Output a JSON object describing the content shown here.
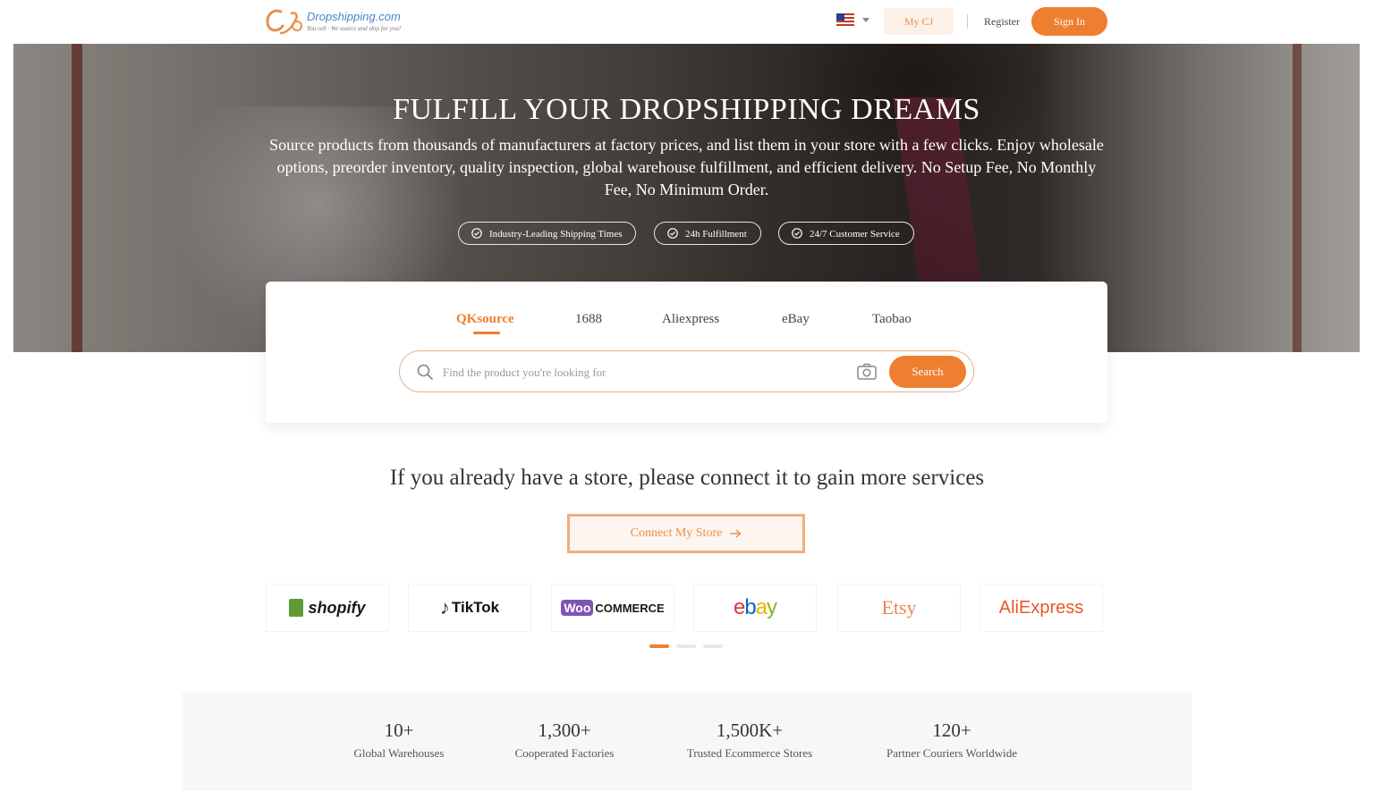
{
  "header": {
    "logo": {
      "name": "Dropshipping.com",
      "tagline": "You sell · We source and ship for you!"
    },
    "language_flag": "us-flag-icon",
    "my_cj_label": "My CJ",
    "register_label": "Register",
    "sign_in_label": "Sign In",
    "accent_color": "#ee7e30"
  },
  "hero": {
    "title": "FULFILL YOUR DROPSHIPPING DREAMS",
    "subtitle": "Source products from thousands of manufacturers at factory prices, and list them in your store with a few clicks. Enjoy wholesale options, preorder inventory, quality inspection, global warehouse fulfillment, and efficient delivery. No Setup Fee, No Monthly Fee, No Minimum Order.",
    "features": [
      {
        "label": "Industry-Leading Shipping Times",
        "icon": "check-circle-icon"
      },
      {
        "label": "24h Fulfillment",
        "icon": "check-circle-icon"
      },
      {
        "label": "24/7 Customer Service",
        "icon": "check-circle-icon"
      }
    ]
  },
  "search": {
    "tabs": [
      {
        "label": "QKsource",
        "active": true
      },
      {
        "label": "1688",
        "active": false
      },
      {
        "label": "Aliexpress",
        "active": false
      },
      {
        "label": "eBay",
        "active": false
      },
      {
        "label": "Taobao",
        "active": false
      }
    ],
    "placeholder": "Find the product you're looking for",
    "button_label": "Search"
  },
  "connect": {
    "title": "If you already have a store, please connect it to gain more services",
    "button_label": "Connect My Store"
  },
  "platforms": [
    {
      "label": "shopify"
    },
    {
      "label": "TikTok"
    },
    {
      "label_box": "Woo",
      "label_rest": "COMMERCE"
    },
    {
      "label": "ebay"
    },
    {
      "label": "Etsy"
    },
    {
      "label": "AliExpress"
    }
  ],
  "carousel": {
    "pages": 3,
    "active_page": 1
  },
  "stats": [
    {
      "value": "10+",
      "label": "Global Warehouses"
    },
    {
      "value": "1,300+",
      "label": "Cooperated Factories"
    },
    {
      "value": "1,500K+",
      "label": "Trusted Ecommerce Stores"
    },
    {
      "value": "120+",
      "label": "Partner Couriers Worldwide"
    }
  ]
}
